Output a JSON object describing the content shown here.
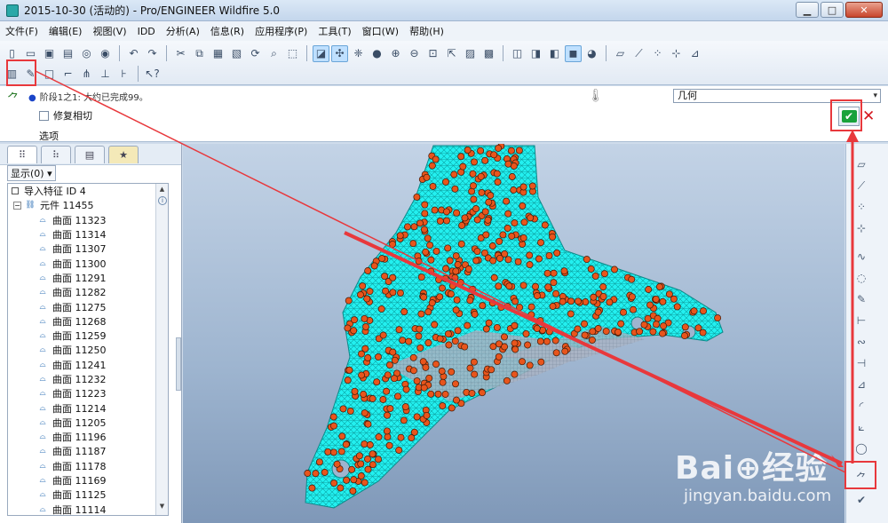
{
  "window": {
    "title": "2015-10-30 (活动的) - Pro/ENGINEER Wildfire 5.0",
    "min_label": "▁",
    "max_label": "□",
    "close_label": "✕"
  },
  "menu": [
    "文件(F)",
    "编辑(E)",
    "视图(V)",
    "IDD",
    "分析(A)",
    "信息(R)",
    "应用程序(P)",
    "工具(T)",
    "窗口(W)",
    "帮助(H)"
  ],
  "dashboard": {
    "message": "阶段1之1: 大约已完成99。",
    "checkbox_label": "修复相切",
    "options_tab": "选项",
    "filter_value": "几何",
    "ok_icon": "✔",
    "cancel_icon": "✕"
  },
  "model_tree": {
    "show_label": "显示",
    "show_count": "(0)",
    "root": "导入特征 ID 4",
    "component": "元件 11455",
    "surfaces": [
      "曲面 11323",
      "曲面 11314",
      "曲面 11307",
      "曲面 11300",
      "曲面 11291",
      "曲面 11282",
      "曲面 11275",
      "曲面 11268",
      "曲面 11259",
      "曲面 11250",
      "曲面 11241",
      "曲面 11232",
      "曲面 11223",
      "曲面 11214",
      "曲面 11205",
      "曲面 11196",
      "曲面 11187",
      "曲面 11178",
      "曲面 11169",
      "曲面 11125",
      "曲面 11114"
    ]
  },
  "watermark": {
    "logo": "Bai⊕经验",
    "url": "jingyan.baidu.com"
  },
  "colors": {
    "mesh": "#23f0f0",
    "points": "#e8551c",
    "annotation": "#e8383c",
    "ok_green": "#19a23b"
  }
}
